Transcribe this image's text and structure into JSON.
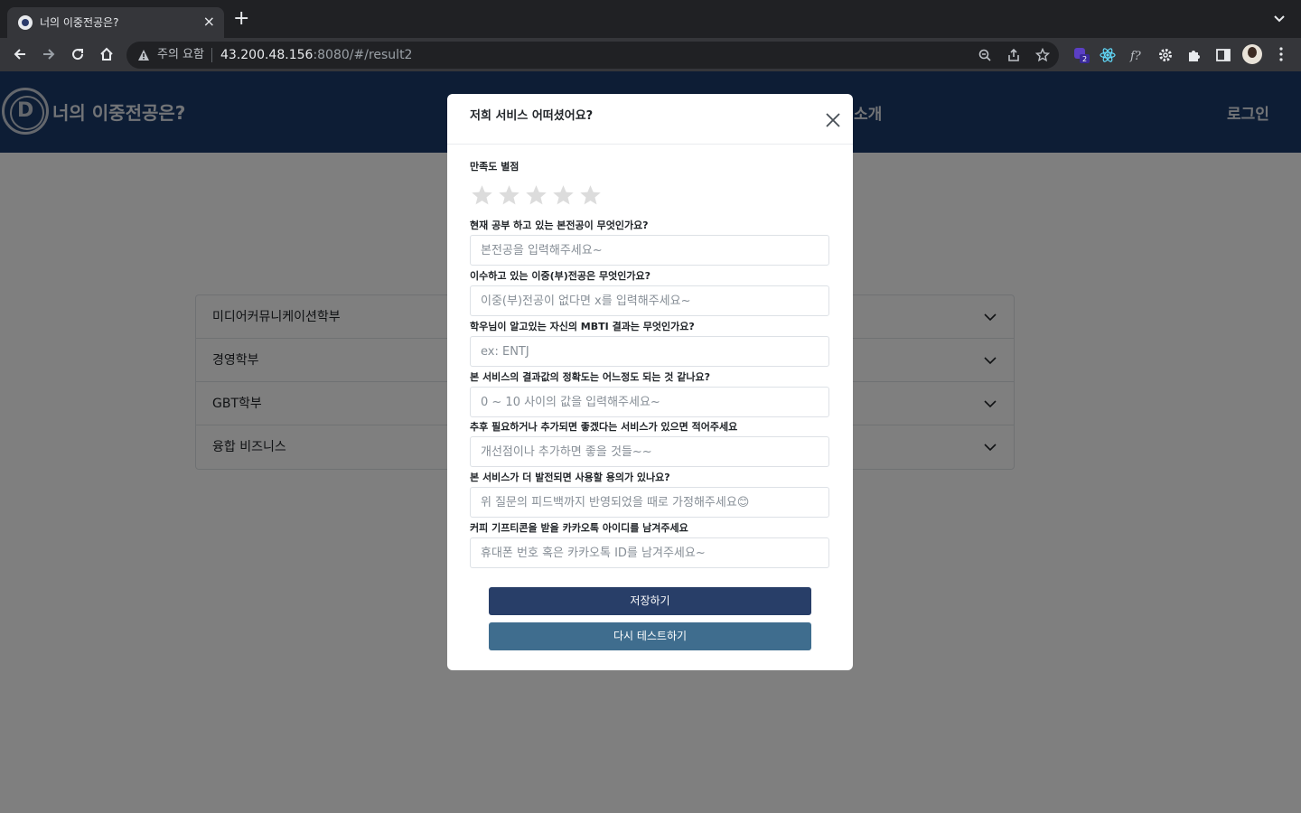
{
  "browser": {
    "tab_title": "너의 이중전공은?",
    "tab_close": "×",
    "new_tab": "+",
    "security_label": "주의 요함",
    "url_host": "43.200.48.156",
    "url_rest": ":8080/#/result2",
    "extension_badge": "2",
    "icons": [
      "back-icon",
      "forward-icon",
      "reload-icon",
      "home-icon",
      "warning-icon",
      "zoom-icon",
      "share-icon",
      "bookmark-star-icon",
      "extension-icon",
      "react-icon",
      "formula-icon",
      "gear-icon",
      "puzzle-icon",
      "side-panel-icon",
      "profile-avatar",
      "menu-icon"
    ]
  },
  "site": {
    "title": "너의 이중전공은?",
    "nav_item": "소개",
    "login": "로그인",
    "header_color": "#1b3a6b"
  },
  "accordion": {
    "items": [
      {
        "label": "미디어커뮤니케이션학부"
      },
      {
        "label": "경영학부"
      },
      {
        "label": "GBT학부"
      },
      {
        "label": "융합 비즈니스"
      }
    ]
  },
  "modal": {
    "title": "저희 서비스 어떠셨어요?",
    "rating_label": "만족도 별점",
    "rating_value": 0,
    "rating_max": 5,
    "fields": [
      {
        "label": "현재 공부 하고 있는 본전공이 무엇인가요?",
        "placeholder": "본전공을 입력해주세요~",
        "value": ""
      },
      {
        "label": "이수하고 있는 이중(부)전공은 무엇인가요?",
        "placeholder": "이중(부)전공이 없다면 x를 입력해주세요~",
        "value": ""
      },
      {
        "label": "학우님이 알고있는 자신의 MBTI 결과는 무엇인가요?",
        "placeholder": "ex: ENTJ",
        "value": ""
      },
      {
        "label": "본 서비스의 결과값의 정확도는 어느정도 되는 것 같나요?",
        "placeholder": "0 ~ 10 사이의 값을 입력해주세요~",
        "value": ""
      },
      {
        "label": "추후 필요하거나 추가되면 좋겠다는 서비스가 있으면 적어주세요",
        "placeholder": "개선점이나 추가하면 좋을 것들~~",
        "value": ""
      },
      {
        "label": "본 서비스가 더 발전되면 사용할 용의가 있나요?",
        "placeholder": "위 질문의 피드백까지 반영되었을 때로 가정해주세요😊",
        "value": ""
      },
      {
        "label": "커피 기프티콘을 받을 카카오톡 아이디를 남겨주세요",
        "placeholder": "휴대폰 번호 혹은 카카오톡 ID를 남겨주세요~",
        "value": ""
      }
    ],
    "save_label": "저장하기",
    "retry_label": "다시 테스트하기",
    "save_color": "#283e68",
    "retry_color": "#3f6d8e"
  }
}
